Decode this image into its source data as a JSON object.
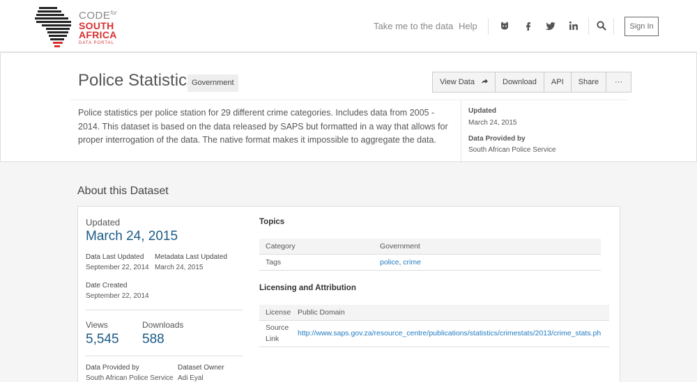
{
  "brand": {
    "code": "CODE",
    "for": "for",
    "country": "SOUTH AFRICA",
    "portal": "DATA PORTAL"
  },
  "nav": {
    "links": [
      "Take me to the data",
      "Help"
    ],
    "icons": [
      "github-icon",
      "facebook-icon",
      "twitter-icon",
      "linkedin-icon",
      "search-icon"
    ],
    "signin": "Sign In"
  },
  "dataset": {
    "title": "Police Statistics",
    "category": "Government",
    "actions": [
      "View Data",
      "Download",
      "API",
      "Share",
      "···"
    ],
    "description": "Police statistics per police station for 29 different crime categories. Includes data from 2005 - 2014. This dataset is based on the data released by SAPS but formatted in a way that allows for proper interrogation of the data. The native format makes it impossible to aggregate the data.",
    "updated_label": "Updated",
    "updated_value": "March 24, 2015",
    "provided_label": "Data Provided by",
    "provided_value": "South African Police Service"
  },
  "about": {
    "title": "About this Dataset",
    "updated_label": "Updated",
    "updated_value": "March 24, 2015",
    "data_last_updated_label": "Data Last Updated",
    "data_last_updated_value": "September 22, 2014",
    "metadata_last_updated_label": "Metadata Last Updated",
    "metadata_last_updated_value": "March 24, 2015",
    "date_created_label": "Date Created",
    "date_created_value": "September 22, 2014",
    "views_label": "Views",
    "views_value": "5,545",
    "downloads_label": "Downloads",
    "downloads_value": "588",
    "provided_label": "Data Provided by",
    "provided_value": "South African Police Service",
    "owner_label": "Dataset Owner",
    "owner_value": "Adi Eyal"
  },
  "topics": {
    "title": "Topics",
    "category_label": "Category",
    "category_value": "Government",
    "tags_label": "Tags",
    "tags": [
      "police",
      "crime"
    ],
    "tag_sep": ", "
  },
  "licensing": {
    "title": "Licensing and Attribution",
    "license_label": "License",
    "license_value": "Public Domain",
    "source_label_1": "Source",
    "source_label_2": "Link",
    "source_value": "http://www.saps.gov.za/resource_centre/publications/statistics/crimestats/2013/crime_stats.ph"
  }
}
